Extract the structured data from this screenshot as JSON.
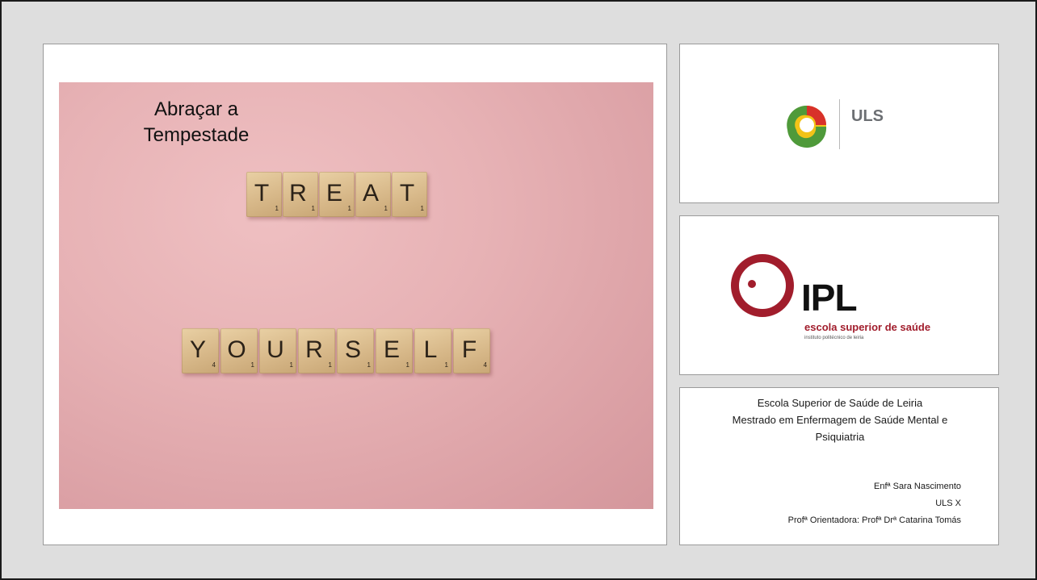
{
  "main": {
    "title": "Abraçar a Tempestade",
    "treat_tiles": [
      {
        "letter": "T",
        "points": "1"
      },
      {
        "letter": "R",
        "points": "1"
      },
      {
        "letter": "E",
        "points": "1"
      },
      {
        "letter": "A",
        "points": "1"
      },
      {
        "letter": "T",
        "points": "1"
      }
    ],
    "yourself_tiles": [
      {
        "letter": "Y",
        "points": "4"
      },
      {
        "letter": "O",
        "points": "1"
      },
      {
        "letter": "U",
        "points": "1"
      },
      {
        "letter": "R",
        "points": "1"
      },
      {
        "letter": "S",
        "points": "1"
      },
      {
        "letter": "E",
        "points": "1"
      },
      {
        "letter": "L",
        "points": "1"
      },
      {
        "letter": "F",
        "points": "4"
      }
    ]
  },
  "uls": {
    "name": "ULS",
    "colors": {
      "green": "#4f9a3a",
      "red": "#d8312a",
      "yellow": "#f2c318"
    }
  },
  "ipl": {
    "name": "IPL",
    "subtitle": "escola superior de saúde",
    "subtitle2": "instituto politécnico de leiria",
    "color": "#a11d2c"
  },
  "info": {
    "line1": "Escola Superior de Saúde de Leiria",
    "line2": "Mestrado em Enfermagem de Saúde Mental e",
    "line3": "Psiquiatria",
    "author": "Enfª Sara Nascimento",
    "org": "ULS X",
    "advisor": "Profª Orientadora: Profª Drª Catarina Tomás"
  }
}
